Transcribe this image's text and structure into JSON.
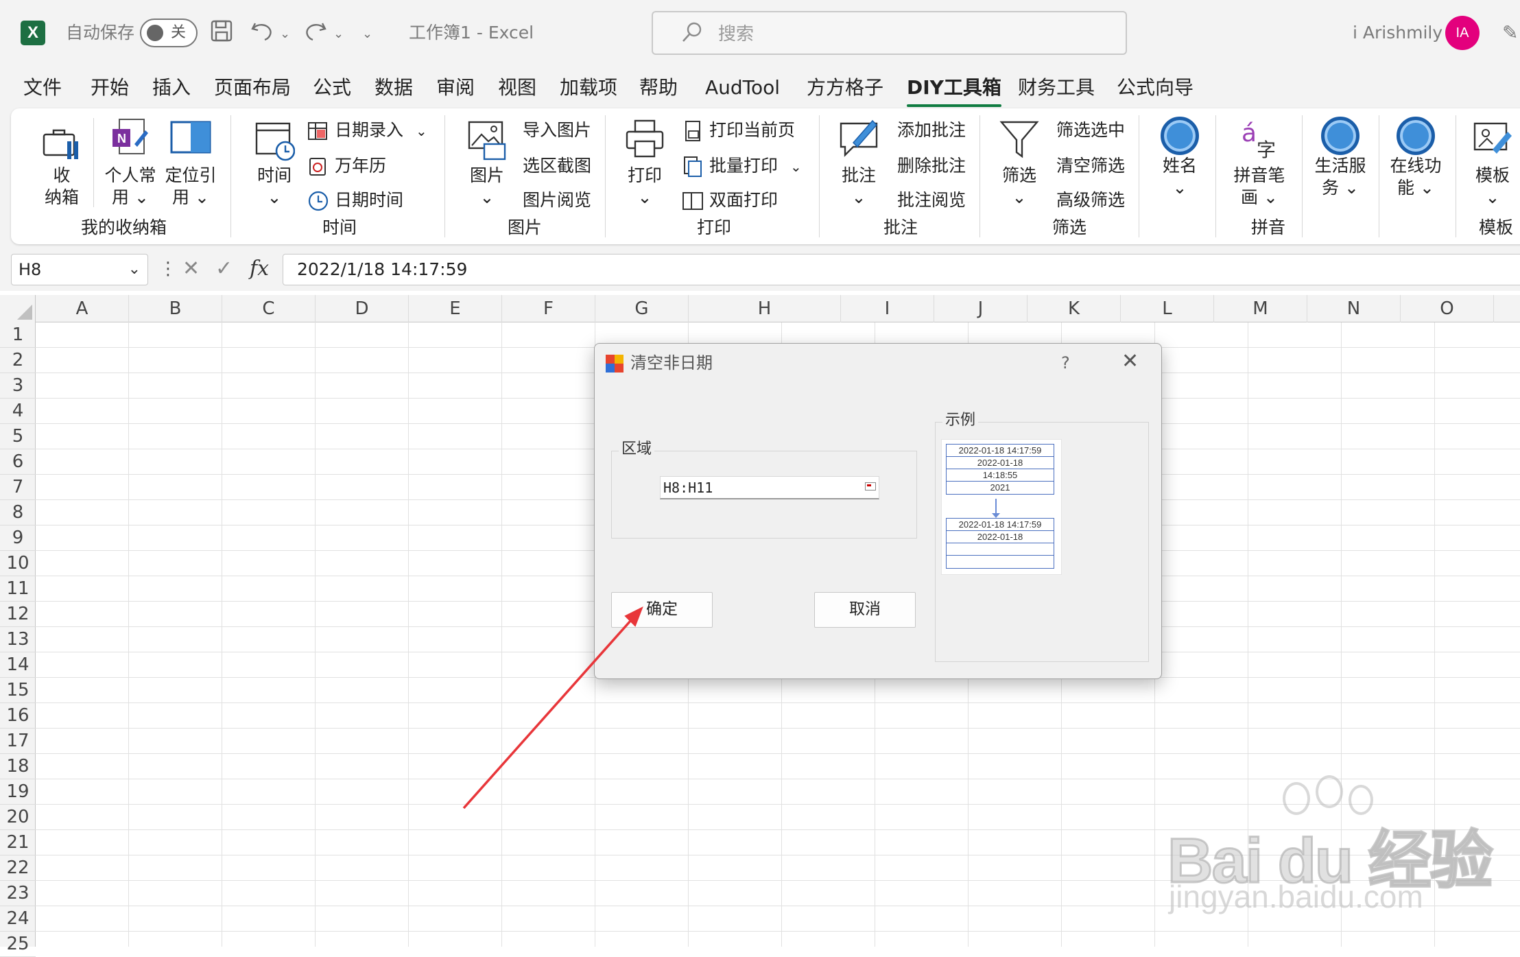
{
  "titlebar": {
    "autosave_label": "自动保存",
    "autosave_state": "关",
    "document_title": "工作簿1  -  Excel",
    "search_placeholder": "搜索",
    "user_name": "i Arishmily",
    "avatar_initials": "IA",
    "accent_color": "#1d6f42"
  },
  "menu": {
    "items": [
      "文件",
      "开始",
      "插入",
      "页面布局",
      "公式",
      "数据",
      "审阅",
      "视图",
      "加载项",
      "帮助",
      "AudTool",
      "方方格子",
      "DIY工具箱",
      "财务工具",
      "公式向导"
    ],
    "active": "DIY工具箱"
  },
  "ribbon": {
    "storage": {
      "btn1": "收",
      "btn1b": "纳箱",
      "btn2": "个人常",
      "btn2b": "用",
      "btn3": "定位引",
      "btn3b": "用",
      "group": "我的收纳箱"
    },
    "time": {
      "big": "时间",
      "s1": "日期录入",
      "s2": "万年历",
      "s3": "日期时间",
      "group": "时间"
    },
    "picture": {
      "big": "图片",
      "s1": "导入图片",
      "s2": "选区截图",
      "s3": "图片阅览",
      "group": "图片"
    },
    "print": {
      "big": "打印",
      "s1": "打印当前页",
      "s2": "批量打印",
      "s3": "双面打印",
      "group": "打印"
    },
    "comment": {
      "big": "批注",
      "s1": "添加批注",
      "s2": "删除批注",
      "s3": "批注阅览",
      "group": "批注"
    },
    "filter": {
      "big": "筛选",
      "s1": "筛选选中",
      "s2": "清空筛选",
      "s3": "高级筛选",
      "group": "筛选"
    },
    "name": {
      "big": "姓名"
    },
    "pinyin": {
      "big": "拼音笔",
      "bigb": "画",
      "group": "拼音"
    },
    "life": {
      "big": "生活服",
      "bigb": "务"
    },
    "online": {
      "big": "在线功",
      "bigb": "能"
    },
    "template": {
      "big": "模板",
      "group": "模板"
    }
  },
  "formula_bar": {
    "name_box": "H8",
    "formula": "2022/1/18  14:17:59",
    "fx": "fx"
  },
  "grid": {
    "columns": [
      "A",
      "B",
      "C",
      "D",
      "E",
      "F",
      "G",
      "H",
      "I",
      "J",
      "K",
      "L",
      "M",
      "N",
      "O"
    ],
    "rows": [
      "1",
      "2",
      "3",
      "4",
      "5",
      "6",
      "7",
      "8",
      "9",
      "10",
      "11",
      "12",
      "13",
      "14",
      "15",
      "16",
      "17",
      "18",
      "19",
      "20",
      "21",
      "22",
      "23",
      "24",
      "25"
    ]
  },
  "dialog": {
    "title": "清空非日期",
    "help": "?",
    "range_label": "区域",
    "range_value": "H8:H11",
    "example_label": "示例",
    "ok_label": "确定",
    "cancel_label": "取消",
    "example_before": [
      "2022-01-18 14:17:59",
      "2022-01-18",
      "14:18:55",
      "2021"
    ],
    "example_after": [
      "2022-01-18 14:17:59",
      "2022-01-18",
      "",
      ""
    ]
  },
  "watermark": {
    "logo": "Bai du 经验",
    "url": "jingyan.baidu.com"
  }
}
